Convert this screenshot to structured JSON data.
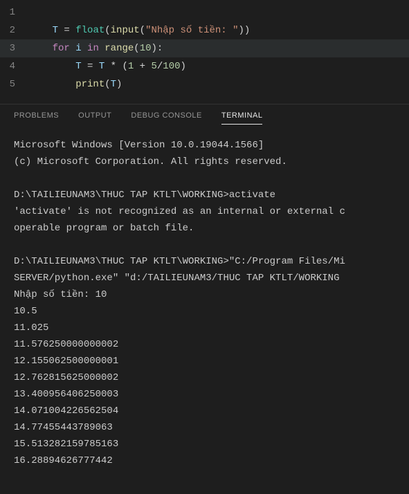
{
  "editor": {
    "lines": [
      {
        "num": "1",
        "tokens": []
      },
      {
        "num": "2",
        "tokens": [
          {
            "t": "var",
            "v": "T"
          },
          {
            "t": "op",
            "v": " = "
          },
          {
            "t": "type",
            "v": "float"
          },
          {
            "t": "punc",
            "v": "("
          },
          {
            "t": "func",
            "v": "input"
          },
          {
            "t": "punc",
            "v": "("
          },
          {
            "t": "str",
            "v": "\"Nhập số tiền: \""
          },
          {
            "t": "punc",
            "v": "))"
          }
        ]
      },
      {
        "num": "3",
        "highlighted": true,
        "tokens": [
          {
            "t": "key",
            "v": "for"
          },
          {
            "t": "op",
            "v": " "
          },
          {
            "t": "var",
            "v": "i"
          },
          {
            "t": "op",
            "v": " "
          },
          {
            "t": "key",
            "v": "in"
          },
          {
            "t": "op",
            "v": " "
          },
          {
            "t": "func",
            "v": "range"
          },
          {
            "t": "punc",
            "v": "("
          },
          {
            "t": "num",
            "v": "10"
          },
          {
            "t": "punc",
            "v": "):"
          }
        ]
      },
      {
        "num": "4",
        "indent": 1,
        "tokens": [
          {
            "t": "var",
            "v": "T"
          },
          {
            "t": "op",
            "v": " = "
          },
          {
            "t": "var",
            "v": "T"
          },
          {
            "t": "op",
            "v": " * ("
          },
          {
            "t": "num",
            "v": "1"
          },
          {
            "t": "op",
            "v": " + "
          },
          {
            "t": "num",
            "v": "5"
          },
          {
            "t": "op",
            "v": "/"
          },
          {
            "t": "num",
            "v": "100"
          },
          {
            "t": "punc",
            "v": ")"
          }
        ]
      },
      {
        "num": "5",
        "indent": 1,
        "tokens": [
          {
            "t": "func",
            "v": "print"
          },
          {
            "t": "punc",
            "v": "("
          },
          {
            "t": "var",
            "v": "T"
          },
          {
            "t": "punc",
            "v": ")"
          }
        ]
      }
    ]
  },
  "tabs": {
    "problems": "PROBLEMS",
    "output": "OUTPUT",
    "debug": "DEBUG CONSOLE",
    "terminal": "TERMINAL",
    "active": "terminal"
  },
  "terminal": {
    "lines": [
      "Microsoft Windows [Version 10.0.19044.1566]",
      "(c) Microsoft Corporation. All rights reserved.",
      "",
      "D:\\TAILIEUNAM3\\THUC TAP KTLT\\WORKING>activate",
      "'activate' is not recognized as an internal or external c",
      "operable program or batch file.",
      "",
      "D:\\TAILIEUNAM3\\THUC TAP KTLT\\WORKING>\"C:/Program Files/Mi",
      "SERVER/python.exe\" \"d:/TAILIEUNAM3/THUC TAP KTLT/WORKING ",
      "Nhập số tiền: 10",
      "10.5",
      "11.025",
      "11.576250000000002",
      "12.155062500000001",
      "12.762815625000002",
      "13.400956406250003",
      "14.071004226562504",
      "14.77455443789063",
      "15.513282159785163",
      "16.28894626777442"
    ]
  }
}
